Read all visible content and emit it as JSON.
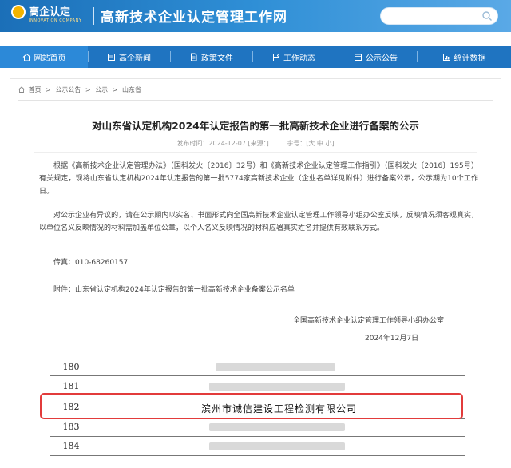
{
  "header": {
    "logo_text": "高企认定",
    "logo_sub": "INNOVATION COMPANY",
    "site_title": "高新技术企业认定管理工作网",
    "search_placeholder": ""
  },
  "nav": {
    "items": [
      {
        "label": "网站首页",
        "icon": "home-icon"
      },
      {
        "label": "高企新闻",
        "icon": "news-icon"
      },
      {
        "label": "政策文件",
        "icon": "document-icon"
      },
      {
        "label": "工作动态",
        "icon": "flag-icon"
      },
      {
        "label": "公示公告",
        "icon": "notice-icon"
      },
      {
        "label": "统计数据",
        "icon": "stats-icon"
      }
    ]
  },
  "breadcrumb": [
    "首页",
    ">",
    "公示公告",
    ">",
    "公示",
    ">",
    "山东省"
  ],
  "article": {
    "title": "对山东省认定机构2024年认定报告的第一批高新技术企业进行备案的公示",
    "meta_date": "发布时间：2024-12-07 [来源：]",
    "meta_font": "字号：[大 中 小]",
    "para1": "根据《高新技术企业认定管理办法》（国科发火〔2016〕32号）和《高新技术企业认定管理工作指引》（国科发火〔2016〕195号）有关规定，现将山东省认定机构2024年认定报告的第一批5774家高新技术企业（企业名单详见附件）进行备案公示，公示期为10个工作日。",
    "para2": "对公示企业有异议的，请在公示期内以实名、书面形式向全国高新技术企业认定管理工作领导小组办公室反映，反映情况须客观真实，以单位名义反映情况的材料需加盖单位公章，以个人名义反映情况的材料应署真实姓名并提供有效联系方式。",
    "fax": "传真：010-68260157",
    "attachment": "附件：山东省认定机构2024年认定报告的第一批高新技术企业备案公示名单",
    "issuer": "全国高新技术企业认定管理工作领导小组办公室",
    "date": "2024年12月7日"
  },
  "table": {
    "rows": [
      {
        "num": "180",
        "company": ""
      },
      {
        "num": "181",
        "company": ""
      },
      {
        "num": "182",
        "company": "滨州市诚信建设工程检测有限公司"
      },
      {
        "num": "183",
        "company": ""
      },
      {
        "num": "184",
        "company": ""
      }
    ],
    "highlight_color": "#e23b3b"
  },
  "colors": {
    "header_start": "#1b6fb8",
    "nav_bg": "#1f74c1",
    "highlight": "#e23b3b"
  }
}
